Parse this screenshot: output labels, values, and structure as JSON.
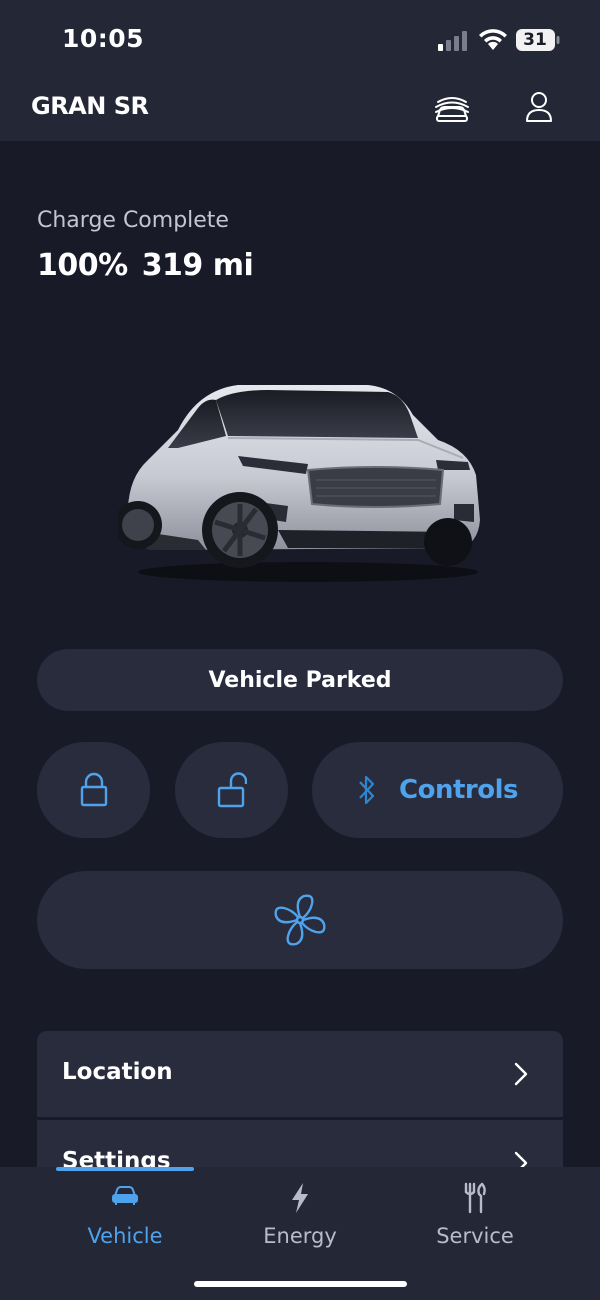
{
  "status_bar": {
    "time": "10:05",
    "battery_level": "31"
  },
  "header": {
    "vehicle_name": "GRAN SR",
    "icons": [
      "car-cover-icon",
      "profile-icon"
    ]
  },
  "charge": {
    "status": "Charge Complete",
    "percent": "100%",
    "range": "319 mi"
  },
  "vehicle_state": "Vehicle Parked",
  "controls": {
    "lock_icon": "lock-icon",
    "unlock_icon": "unlock-icon",
    "controls_label": "Controls",
    "bluetooth_icon": "bluetooth-icon",
    "climate_icon": "fan-icon"
  },
  "menu": [
    {
      "label": "Location"
    },
    {
      "label": "Settings"
    }
  ],
  "tabs": [
    {
      "label": "Vehicle",
      "icon": "car-icon",
      "active": true
    },
    {
      "label": "Energy",
      "icon": "lightning-icon",
      "active": false
    },
    {
      "label": "Service",
      "icon": "tools-icon",
      "active": false
    }
  ],
  "colors": {
    "accent": "#4fa3ec",
    "background": "#181b27",
    "surface": "#282c3d",
    "bar": "#242736"
  }
}
